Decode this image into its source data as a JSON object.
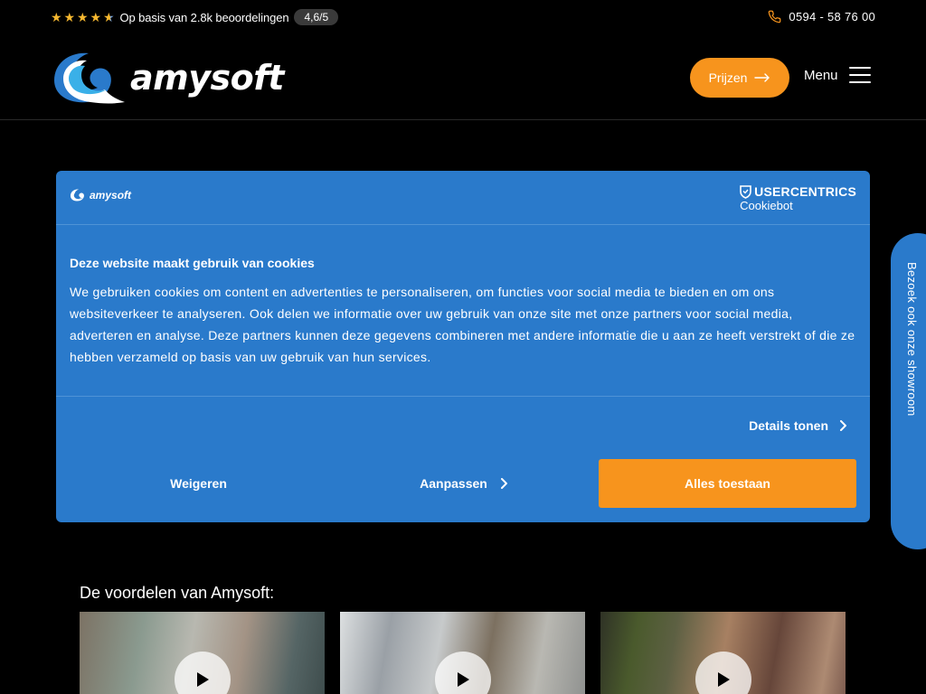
{
  "topbar": {
    "rating_text": "Op basis van 2.8k beoordelingen",
    "rating_score": "4,6/5",
    "phone": "0594 - 58 76 00"
  },
  "header": {
    "logo_text": "amysoft",
    "prices_label": "Prijzen",
    "menu_label": "Menu"
  },
  "cookie": {
    "logo_text": "amysoft",
    "provider_top": "USERCENTRICS",
    "provider_bottom": "Cookiebot",
    "title": "Deze website maakt gebruik van cookies",
    "text": "We gebruiken cookies om content en advertenties te personaliseren, om functies voor social media te bieden en om ons websiteverkeer te analyseren. Ook delen we informatie over uw gebruik van onze site met onze partners voor social media, adverteren en analyse. Deze partners kunnen deze gegevens combineren met andere informatie die u aan ze heeft verstrekt of die ze hebben verzameld op basis van uw gebruik van hun services.",
    "details_label": "Details tonen",
    "refuse_label": "Weigeren",
    "customize_label": "Aanpassen",
    "allow_label": "Alles toestaan"
  },
  "sidetab": {
    "label": "Bezoek ook onze showroom"
  },
  "advantages": {
    "title": "De voordelen van Amysoft:"
  },
  "colors": {
    "accent": "#f7941d",
    "dialog": "#2a7acb",
    "star": "#f6b830"
  },
  "icons": [
    "star-icon",
    "phone-icon",
    "arrow-right-icon",
    "hamburger-icon",
    "shield-icon",
    "chevron-right-icon",
    "play-icon",
    "wave-logo-icon"
  ]
}
